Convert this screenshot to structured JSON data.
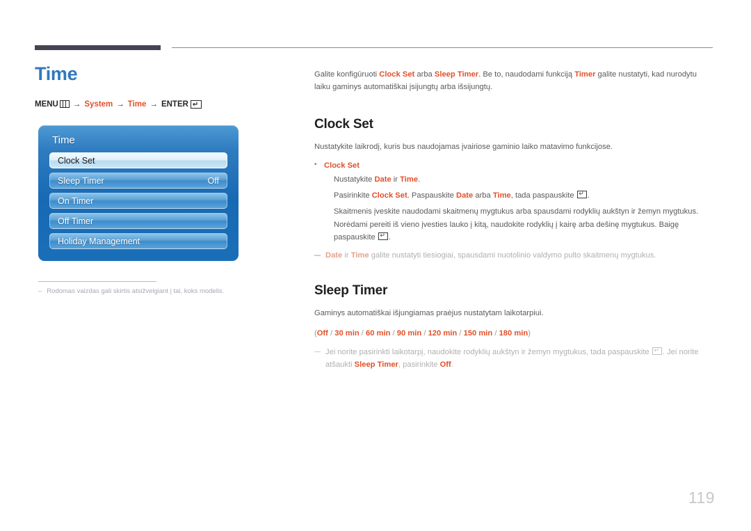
{
  "page": {
    "title": "Time",
    "number": "119"
  },
  "breadcrumb": {
    "menu_label": "MENU",
    "menu_icon": "menu-bars-icon",
    "arrow": "→",
    "item1": "System",
    "item2": "Time",
    "enter_label": "ENTER",
    "enter_icon": "enter-return-icon"
  },
  "osd": {
    "title": "Time",
    "rows": [
      {
        "label": "Clock Set",
        "value": "",
        "selected": true
      },
      {
        "label": "Sleep Timer",
        "value": "Off",
        "selected": false
      },
      {
        "label": "On Timer",
        "value": "",
        "selected": false
      },
      {
        "label": "Off Timer",
        "value": "",
        "selected": false
      },
      {
        "label": "Holiday Management",
        "value": "",
        "selected": false
      }
    ]
  },
  "left_footnote": {
    "dash": "–",
    "text": "Rodomas vaizdas gali skirtis atsižvelgiant į tai, koks modelis."
  },
  "intro": {
    "p1_a": "Galite konfigūruoti ",
    "p1_b": "Clock Set",
    "p1_c": " arba ",
    "p1_d": "Sleep Timer",
    "p1_e": ". Be to, naudodami funkciją ",
    "p1_f": "Timer",
    "p1_g": " galite nustatyti, kad nurodytu laiku gaminys automatiškai įsijungtų arba išsijungtų."
  },
  "clock_set": {
    "heading": "Clock Set",
    "lead": "Nustatykite laikrodį, kuris bus naudojamas įvairiose gaminio laiko matavimo funkcijose.",
    "bullet_head": "Clock Set",
    "line1_a": "Nustatykite ",
    "line1_b": "Date",
    "line1_c": " ir ",
    "line1_d": "Time",
    "line1_e": ".",
    "line2_a": "Pasirinkite ",
    "line2_b": "Clock Set",
    "line2_c": ". Paspauskite ",
    "line2_d": "Date",
    "line2_e": " arba ",
    "line2_f": "Time",
    "line2_g": ", tada paspauskite ",
    "line2_h": ".",
    "line3_a": "Skaitmenis įveskite naudodami skaitmenų mygtukus arba spausdami rodyklių aukštyn ir žemyn mygtukus. Norėdami pereiti iš vieno įvesties lauko į kitą, naudokite rodyklių į kairę arba dešinę mygtukus. Baigę paspauskite ",
    "line3_b": ".",
    "note_a": "Date",
    "note_b": " ir ",
    "note_c": "Time",
    "note_d": " galite nustatyti tiesiogiai, spausdami nuotolinio valdymo pulto skaitmenų mygtukus."
  },
  "sleep_timer": {
    "heading": "Sleep Timer",
    "lead": "Gaminys automatiškai išjungiamas praėjus nustatytam laikotarpiui.",
    "options_open": "(",
    "options": [
      "Off",
      "30 min",
      "60 min",
      "90 min",
      "120 min",
      "150 min",
      "180 min"
    ],
    "options_sep": " / ",
    "options_close": ")",
    "note_a": "Jei norite pasirinkti laikotarpį, naudokite rodyklių aukštyn ir žemyn mygtukus, tada paspauskite ",
    "note_b": ". Jei norite atšaukti ",
    "note_c": "Sleep Timer",
    "note_d": ", pasirinkite ",
    "note_e": "Off",
    "note_f": "."
  },
  "colors": {
    "accent_orange": "#e2502a",
    "title_blue": "#3178bd",
    "rule_dark": "#464355",
    "osd_blue": "#1769b4",
    "page_number": "#c8c8c8"
  }
}
